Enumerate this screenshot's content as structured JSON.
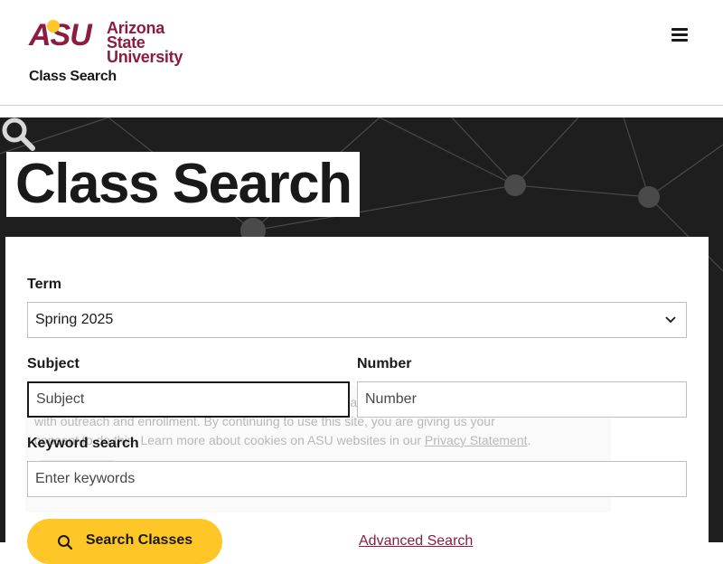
{
  "header": {
    "logo_abbrev": "ASU",
    "logo_name_line1": "Arizona State",
    "logo_name_line2": "University",
    "site_title": "Class Search",
    "menu_icon": "hamburger-menu-icon"
  },
  "hero": {
    "title": "Class Search",
    "decor_icon": "magnifier-icon"
  },
  "form": {
    "term_label": "Term",
    "term_value": "Spring 2025",
    "subject_label": "Subject",
    "subject_placeholder": "Subject",
    "number_label": "Number",
    "number_placeholder": "Number",
    "keyword_label": "Keyword search",
    "keyword_placeholder": "Enter keywords",
    "search_button": "Search Classes",
    "advanced_link": "Advanced Search"
  },
  "cookie_notice": {
    "text_before_link": "ASU websites use cookies to enhance user experience, analyze site usage, and assist with outreach and enrollment. By continuing to use this site, you are giving us your consent to do this. Learn more about cookies on ASU websites in our",
    "link_text": "Privacy Statement",
    "text_after_link": ".",
    "close_label": "×"
  },
  "colors": {
    "maroon": "#8c1d40",
    "gold": "#ffc627",
    "hero_bg": "#1e1e1e",
    "text": "#191919"
  }
}
